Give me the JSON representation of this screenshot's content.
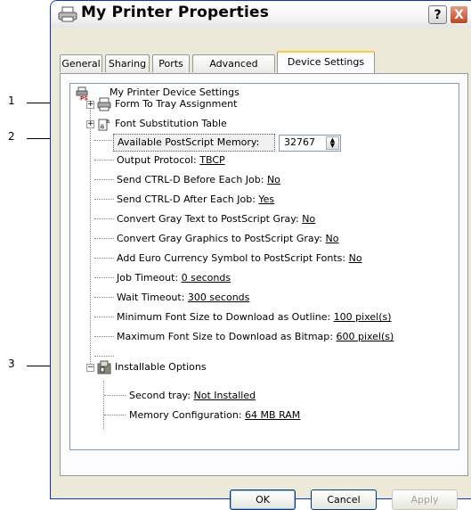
{
  "callouts": [
    "1",
    "2",
    "3"
  ],
  "window": {
    "title": "My Printer Properties",
    "help_label": "?",
    "close_label": "X"
  },
  "tabs": [
    {
      "label": "General"
    },
    {
      "label": "Sharing"
    },
    {
      "label": "Ports"
    },
    {
      "label": "Advanced"
    },
    {
      "label": "Device Settings",
      "active": true
    }
  ],
  "tree": {
    "root": "My Printer Device Settings",
    "form_to_tray": "Form To Tray Assignment",
    "font_substitution": "Font Substitution Table",
    "available_memory_label": "Available PostScript Memory:",
    "available_memory_value": "32767",
    "settings": [
      {
        "label": "Output Protocol:",
        "value": "TBCP"
      },
      {
        "label": "Send CTRL-D Before Each Job:",
        "value": "No"
      },
      {
        "label": "Send CTRL-D After Each Job:",
        "value": "Yes"
      },
      {
        "label": "Convert Gray Text to PostScript Gray:",
        "value": "No"
      },
      {
        "label": "Convert Gray Graphics to PostScript Gray:",
        "value": "No"
      },
      {
        "label": "Add Euro Currency Symbol to PostScript Fonts:",
        "value": "No"
      },
      {
        "label": "Job Timeout:",
        "value": "0 seconds"
      },
      {
        "label": "Wait Timeout:",
        "value": "300 seconds"
      },
      {
        "label": "Minimum Font Size to Download as Outline:",
        "value": "100 pixel(s)"
      },
      {
        "label": "Maximum Font Size to Download as Bitmap:",
        "value": "600 pixel(s)"
      }
    ],
    "installable_options": "Installable Options",
    "options": [
      {
        "label": "Second tray:",
        "value": "Not Installed"
      },
      {
        "label": "Memory Configuration:",
        "value": "64 MB RAM"
      }
    ]
  },
  "buttons": {
    "ok": "OK",
    "cancel": "Cancel",
    "apply": "Apply"
  },
  "colors": {
    "window_border": "#0831D9",
    "dialog_bg": "#ECE9D8",
    "active_tab_accent": "#FFC83C",
    "close_button": "#C4431C"
  }
}
